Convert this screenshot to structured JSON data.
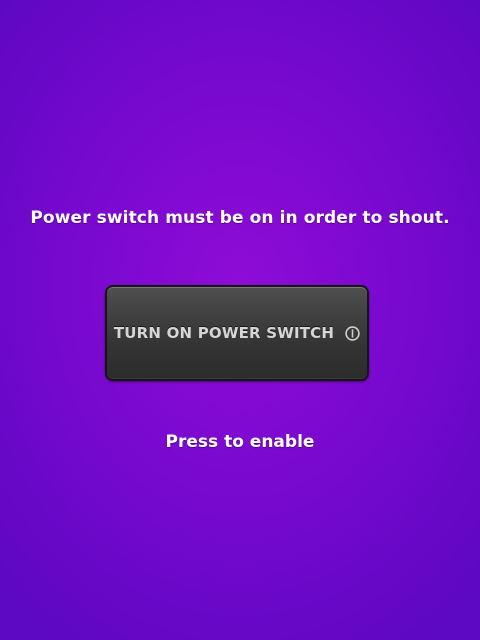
{
  "screen": {
    "background_color": "#7a09cf",
    "message": "Power switch must be on in order to shout.",
    "power_button": {
      "label": "TURN ON POWER SWITCH",
      "icon": "info-icon",
      "color": "#3f3f3f"
    },
    "hint": "Press to enable"
  }
}
